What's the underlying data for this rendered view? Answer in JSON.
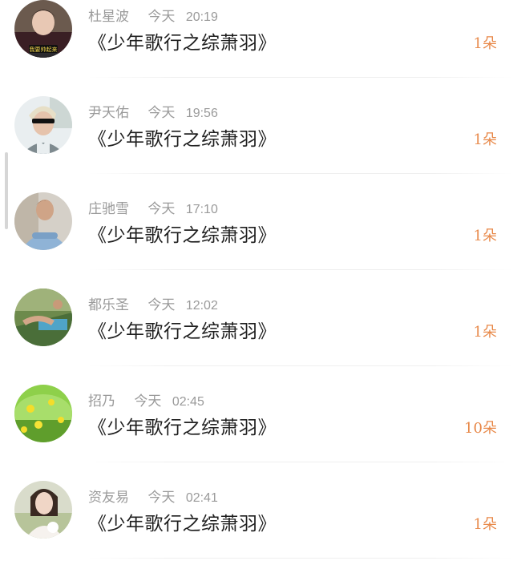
{
  "records": [
    {
      "name": "杜星波",
      "day": "今天",
      "time": "20:19",
      "gift": "《少年歌行之综萧羽》",
      "count": "1朵",
      "avatar": "avatar-1",
      "avatar_text": "我要帅起来"
    },
    {
      "name": "尹天佑",
      "day": "今天",
      "time": "19:56",
      "gift": "《少年歌行之综萧羽》",
      "count": "1朵",
      "avatar": "avatar-2"
    },
    {
      "name": "庄驰雪",
      "day": "今天",
      "time": "17:10",
      "gift": "《少年歌行之综萧羽》",
      "count": "1朵",
      "avatar": "avatar-3"
    },
    {
      "name": "都乐圣",
      "day": "今天",
      "time": "12:02",
      "gift": "《少年歌行之综萧羽》",
      "count": "1朵",
      "avatar": "avatar-4"
    },
    {
      "name": "招乃",
      "day": "今天",
      "time": "02:45",
      "gift": "《少年歌行之综萧羽》",
      "count": "10朵",
      "avatar": "avatar-5"
    },
    {
      "name": "资友易",
      "day": "今天",
      "time": "02:41",
      "gift": "《少年歌行之综萧羽》",
      "count": "1朵",
      "avatar": "avatar-6"
    }
  ],
  "colors": {
    "count_orange": "#e8894a",
    "meta_gray": "#9a9a9a",
    "title_dark": "#1f1f1f"
  }
}
